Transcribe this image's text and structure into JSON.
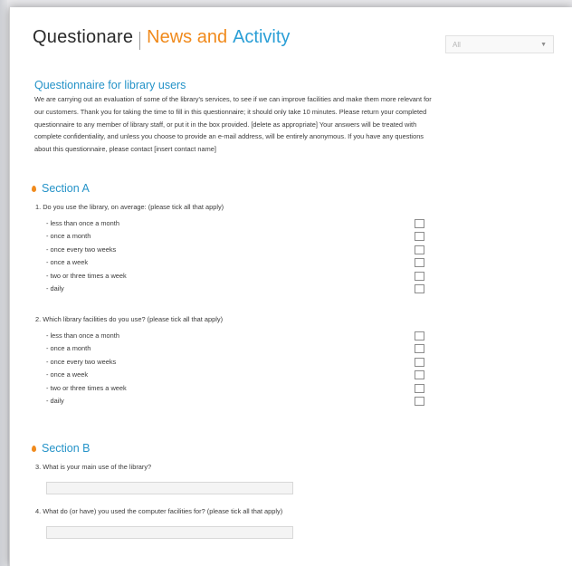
{
  "header": {
    "title": "Questionare",
    "news": "News and",
    "activity": "Activity"
  },
  "filter": {
    "selected": "All",
    "caret_icon": "chevron-down-icon"
  },
  "questionnaire": {
    "title": "Questionnaire for library users",
    "intro_lines": [
      "We are carrying out an evaluation of some of the library's services, to see if we can improve facilities and make them more relevant for",
      "our customers.  Thank you for taking the time to fill in this questionnaire; it should only take 10 minutes.  Please return your completed",
      "questionnaire to any member of library staff, or put it in the box provided. [delete as appropriate] Your answers will be treated with",
      "complete confidentiality, and unless you choose to provide an e-mail address, will be entirely anonymous.  If you have any questions",
      "about this questionnaire, please contact [insert contact name]"
    ]
  },
  "section_a": {
    "title": "Section A",
    "q1": {
      "text": "1.  Do you use the library, on average: (please tick all that apply)",
      "options": [
        "- less than once a month",
        "- once a month",
        "- once every two weeks",
        "- once a week",
        "- two or three times a week",
        "- daily"
      ]
    },
    "q2": {
      "text": "2.  Which library facilities do you use?  (please tick all that apply)",
      "options": [
        "- less than once a month",
        "- once a month",
        "- once every two weeks",
        "- once a week",
        "- two or three times a week",
        "- daily"
      ]
    }
  },
  "section_b": {
    "title": "Section B",
    "q3": {
      "text": "3.  What is your main use of the library?",
      "value": ""
    },
    "q4": {
      "text": "4.  What do (or have) you used the computer facilities for?  (please tick all that apply)",
      "value": ""
    }
  },
  "colors": {
    "accent_blue": "#2593c8",
    "accent_orange": "#f08a1c"
  }
}
